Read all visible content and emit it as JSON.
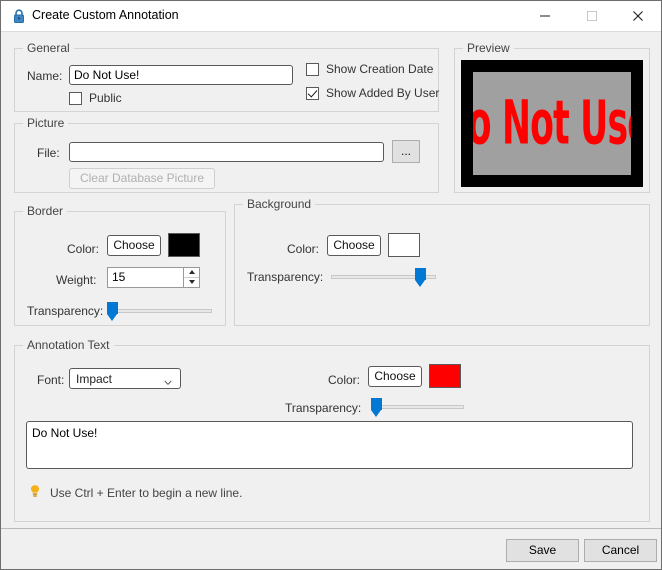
{
  "window": {
    "title": "Create Custom Annotation",
    "icon": "lock-icon",
    "minimize_label": "Minimize",
    "maximize_label": "Maximize",
    "close_label": "Close"
  },
  "general": {
    "legend": "General",
    "name_label": "Name:",
    "name_value": "Do Not Use!",
    "name_placeholder": "",
    "public": {
      "label": "Public",
      "checked": false
    },
    "show_creation_date": {
      "label": "Show Creation Date",
      "checked": false
    },
    "show_added_by_user": {
      "label": "Show Added By User",
      "checked": true
    }
  },
  "preview": {
    "legend": "Preview",
    "text": "Do Not Use!",
    "text_color": "#ff0000",
    "background_color": "#a0a0a0",
    "border_color": "#000000"
  },
  "picture": {
    "legend": "Picture",
    "file_label": "File:",
    "file_value": "",
    "file_placeholder": "",
    "browse_label": "...",
    "clear_label": "Clear Database Picture",
    "clear_enabled": false
  },
  "border": {
    "legend": "Border",
    "color_label": "Color:",
    "choose_label": "Choose",
    "color_value": "#000000",
    "weight_label": "Weight:",
    "weight_value": "15",
    "transparency_label": "Transparency:",
    "transparency_percent": 5
  },
  "background": {
    "legend": "Background",
    "color_label": "Color:",
    "choose_label": "Choose",
    "color_value": "#ffffff",
    "transparency_label": "Transparency:",
    "transparency_percent": 85
  },
  "annotation_text": {
    "legend": "Annotation Text",
    "font_label": "Font:",
    "font_value": "Impact",
    "color_label": "Color:",
    "choose_label": "Choose",
    "color_value": "#ff0000",
    "transparency_label": "Transparency:",
    "transparency_percent": 5,
    "text_value": "Do Not Use!",
    "text_placeholder": "",
    "hint": "Use Ctrl + Enter to begin a new line.",
    "hint_icon": "lightbulb-icon"
  },
  "footer": {
    "save_label": "Save",
    "cancel_label": "Cancel"
  }
}
